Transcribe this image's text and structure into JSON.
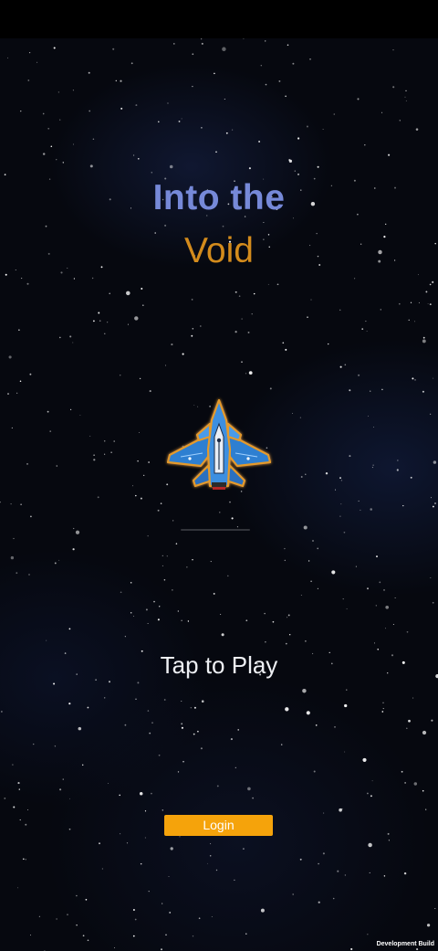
{
  "title": {
    "line1": "Into the",
    "line2": "Void"
  },
  "prompt": {
    "tap_to_play": "Tap to Play"
  },
  "login": {
    "label": "Login"
  },
  "footer": {
    "build_label": "Development Build"
  },
  "colors": {
    "title_line1": "#7689d8",
    "title_line2": "#d38b1c",
    "login_button": "#f5a30b"
  },
  "icons": {
    "player_ship": "fighter-jet-icon"
  }
}
